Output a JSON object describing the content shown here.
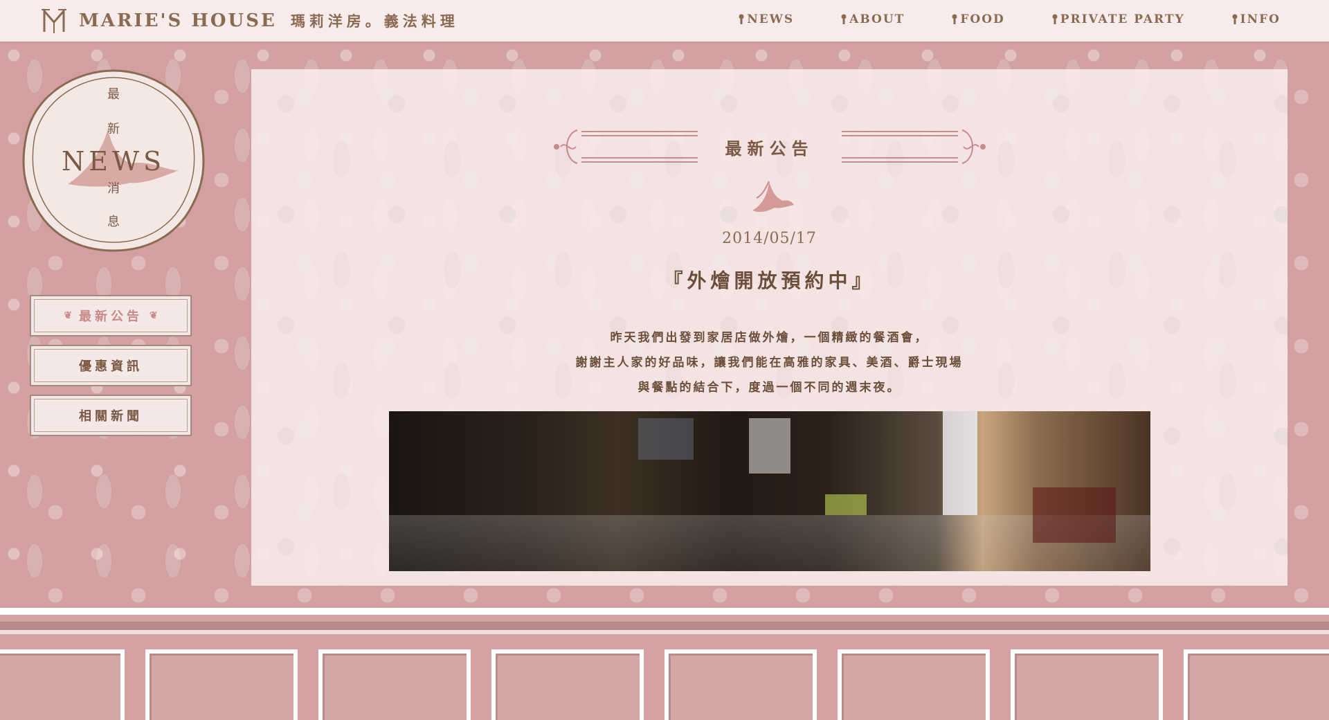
{
  "header": {
    "logo_text": "MARIE'S HOUSE",
    "logo_subtitle": "瑪莉洋房。義法料理",
    "nav": [
      {
        "label": "NEWS"
      },
      {
        "label": "ABOUT"
      },
      {
        "label": "FOOD"
      },
      {
        "label": "PRIVATE PARTY"
      },
      {
        "label": "INFO"
      }
    ]
  },
  "sidebar": {
    "emblem": {
      "title": "NEWS",
      "vertical_chars": [
        "最",
        "新",
        "消",
        "息"
      ]
    },
    "buttons": [
      {
        "label": "最新公告",
        "active": true
      },
      {
        "label": "優惠資訊",
        "active": false
      },
      {
        "label": "相關新聞",
        "active": false
      }
    ]
  },
  "article": {
    "section_heading": "最新公告",
    "date": "2014/05/17",
    "title": "『外燴開放預約中』",
    "lines": [
      "昨天我們出發到家居店做外燴，一個精緻的餐酒會，",
      "謝謝主人家的好品味，讓我們能在高雅的家具、美酒、爵士現場",
      "與餐點的結合下，度過一個不同的週末夜。"
    ]
  },
  "colors": {
    "wallpaper": "#d2a0a0",
    "panel": "#f8ecec",
    "text_brown": "#7a5a45",
    "accent_pink": "#c98a8a"
  },
  "icons": {
    "nav_marker": "keyhole-icon",
    "logo": "m-monogram-icon",
    "bird": "swallow-icon"
  }
}
